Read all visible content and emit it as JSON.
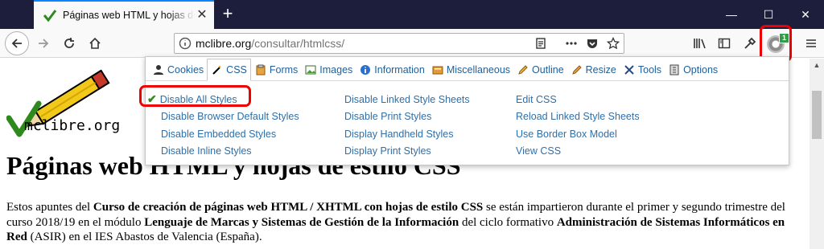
{
  "tab": {
    "title": "Páginas web HTML y hojas de estilo CSS",
    "close": "✕"
  },
  "window": {
    "minimize": "—",
    "maximize": "☐",
    "close": "✕",
    "new_tab": "+"
  },
  "url": {
    "host": "mclibre.org",
    "path": "/consultar/htmlcss/"
  },
  "extension": {
    "badge": "1"
  },
  "panel": {
    "tabs": [
      "Cookies",
      "CSS",
      "Forms",
      "Images",
      "Information",
      "Miscellaneous",
      "Outline",
      "Resize",
      "Tools",
      "Options"
    ],
    "active_tab": "CSS",
    "columns": [
      [
        "Disable All Styles",
        "Disable Browser Default Styles",
        "Disable Embedded Styles",
        "Disable Inline Styles"
      ],
      [
        "Disable Linked Style Sheets",
        "Disable Print Styles",
        "Display Handheld Styles",
        "Display Print Styles"
      ],
      [
        "Edit CSS",
        "Reload Linked Style Sheets",
        "Use Border Box Model",
        "View CSS"
      ]
    ]
  },
  "page": {
    "logo_text": "mclibre.org",
    "heading": "Páginas web HTML y hojas de estilo CSS",
    "p1": "Estos apuntes del ",
    "b1": "Curso de creación de páginas web HTML / XHTML con hojas de estilo CSS",
    "p2": " se están impartieron durante el primer y segundo trimestre del curso 2018/19 en el módulo ",
    "b2": "Lenguaje de Marcas y Sistemas de Gestión de la Información",
    "p3": " del ciclo formativo ",
    "b3": "Administración de Sistemas Informáticos en Red",
    "p4": " (ASIR) en el IES Abastos de Valencia (España)."
  },
  "colors": {
    "titlebar": "#1d1d3c",
    "link": "#2f6fa8",
    "highlight": "#e00000"
  }
}
